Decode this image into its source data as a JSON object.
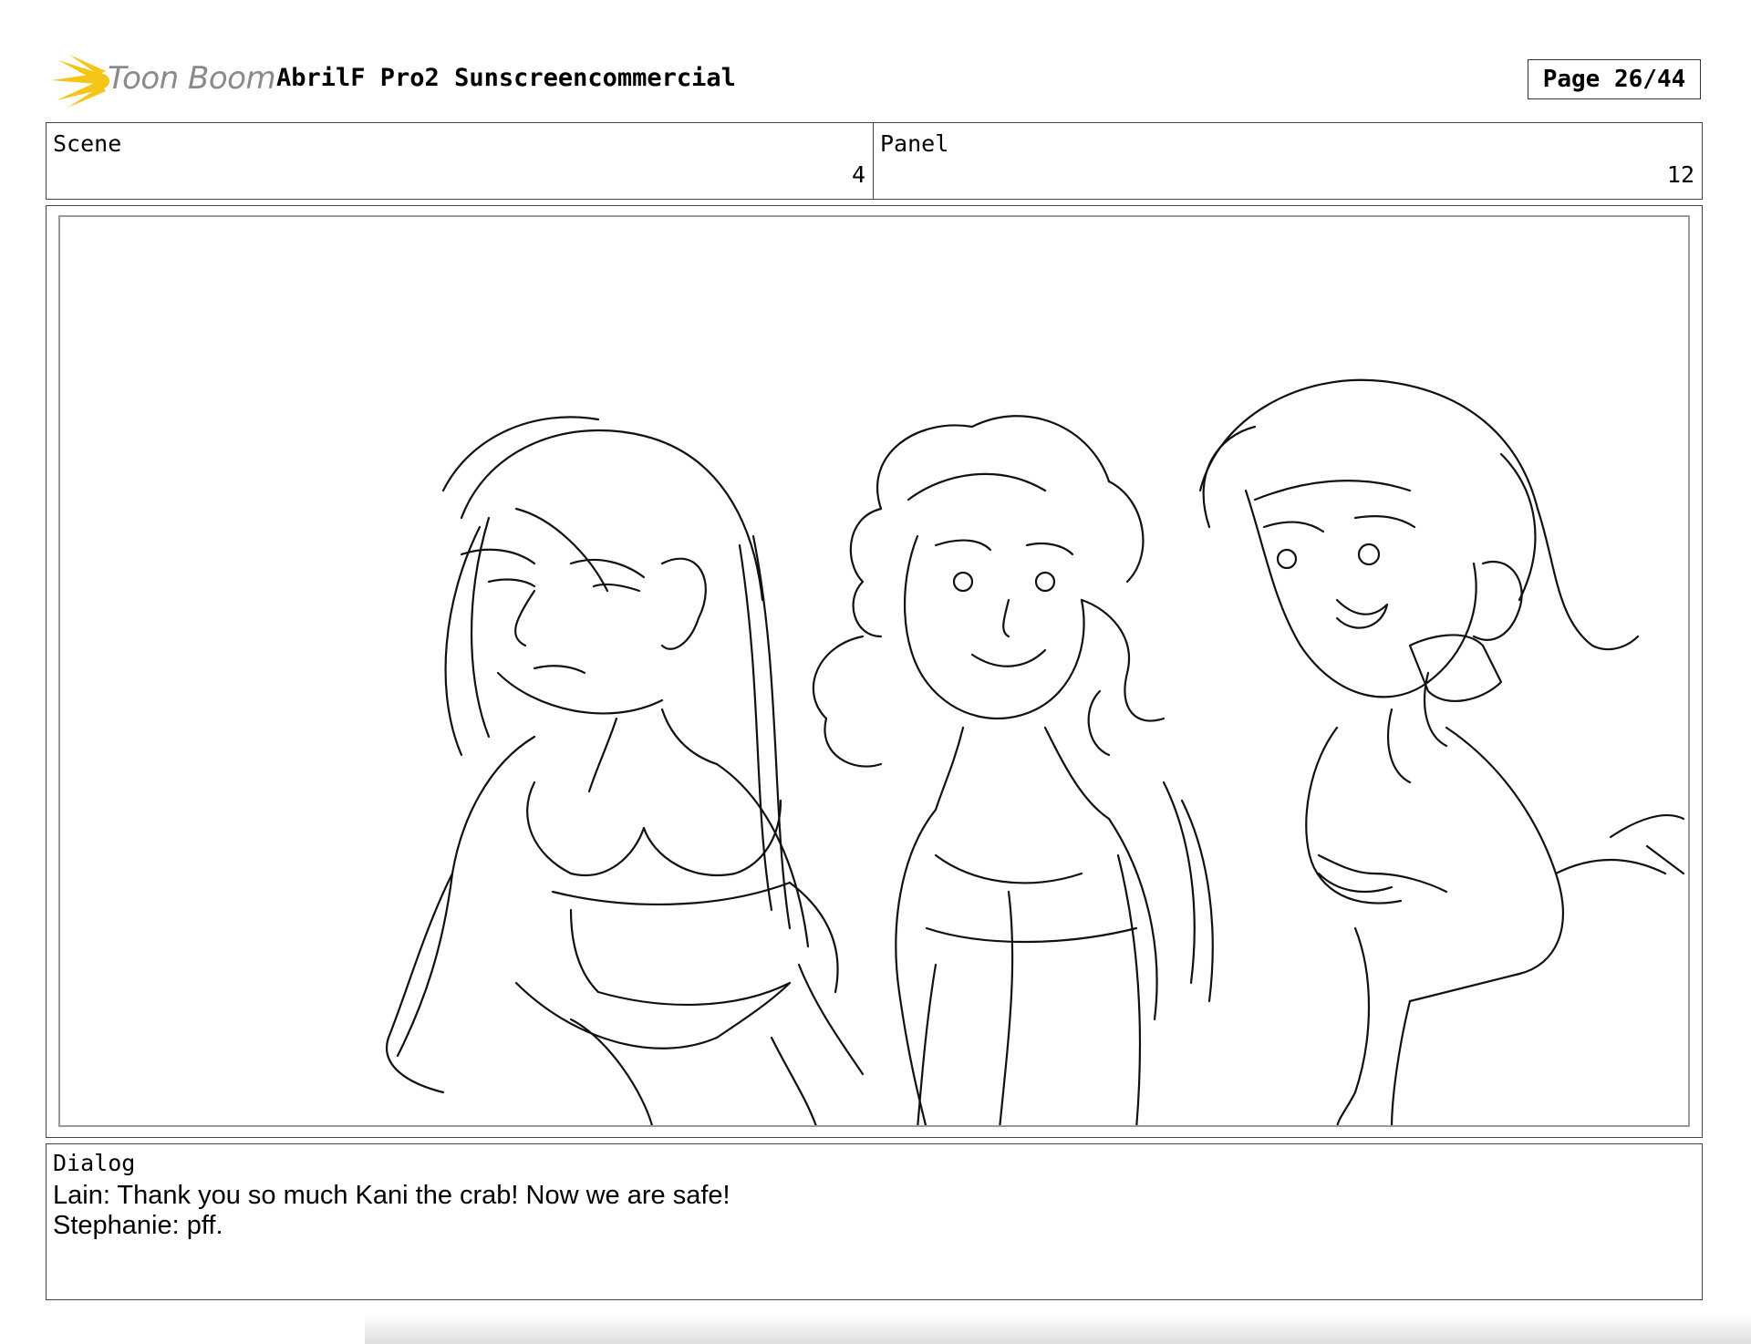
{
  "header": {
    "logo_text": "Toon Boom",
    "project_title": "AbrilF Pro2 Sunscreencommercial",
    "page_label": "Page 26/44"
  },
  "info": {
    "scene_label": "Scene",
    "scene_value": "4",
    "panel_label": "Panel",
    "panel_value": "12"
  },
  "dialog": {
    "label": "Dialog",
    "lines": [
      "Lain: Thank you so much Kani the crab!  Now we are safe!",
      "Stephanie: pff."
    ]
  },
  "colors": {
    "logo_star": "#f5c518",
    "logo_text": "#8a8a8a",
    "border": "#444444",
    "inner_frame": "#9a9a9a"
  }
}
